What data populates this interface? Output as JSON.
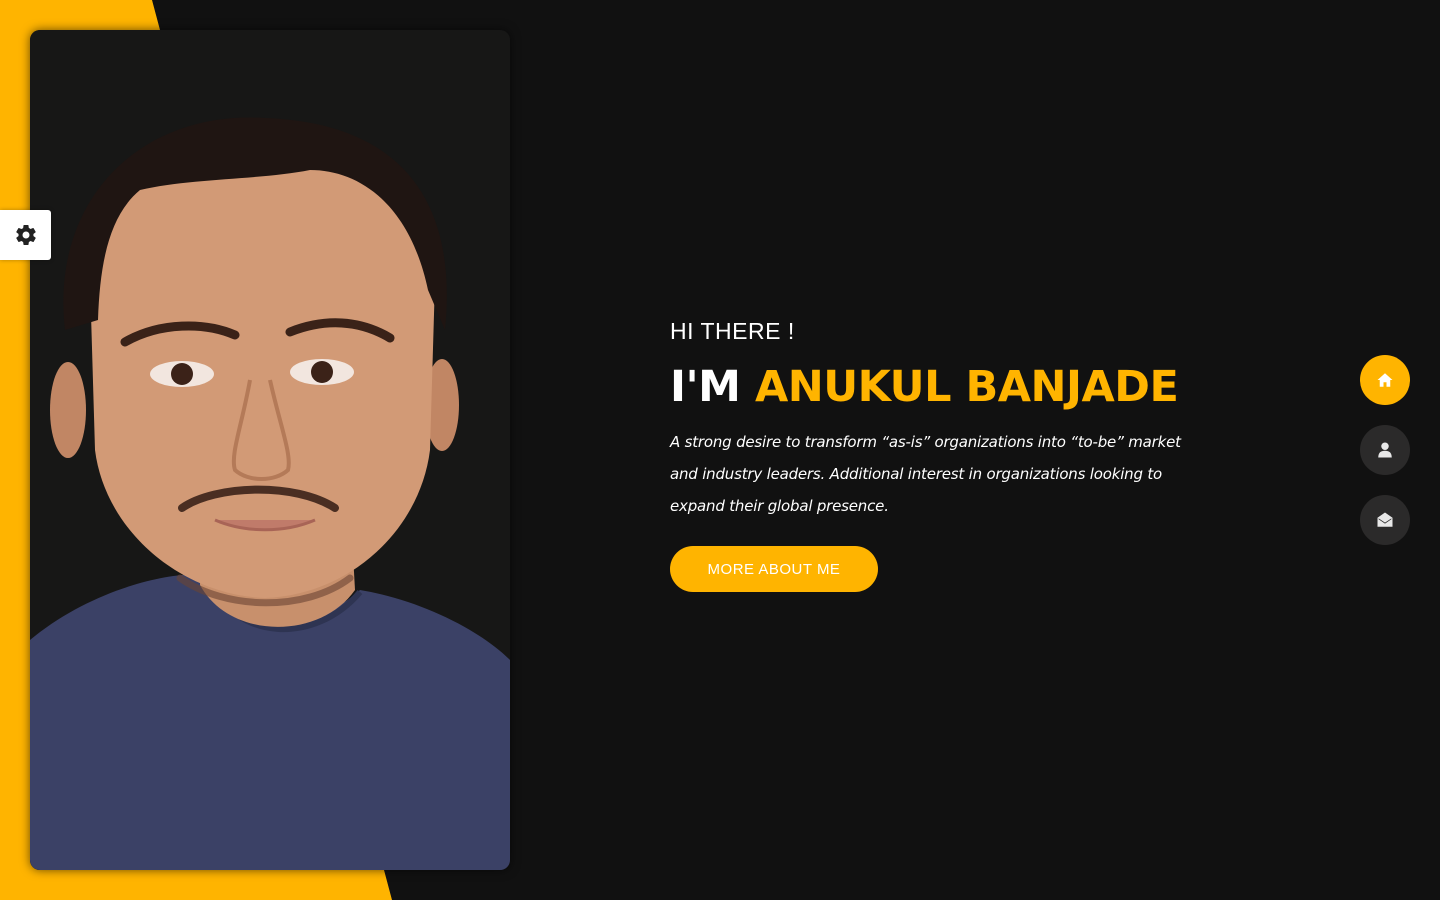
{
  "colors": {
    "accent": "#ffb400",
    "background": "#111111",
    "nav_button": "#2b2a2a",
    "text": "#ffffff"
  },
  "settings": {
    "icon": "gear-icon"
  },
  "hero": {
    "greeting": "HI THERE !",
    "headline_prefix": "I'M ",
    "headline_name": "ANUKUL BANJADE",
    "bio": "A strong desire to transform “as-is” organizations into “to-be” market and industry leaders. Additional interest in organizations looking to expand their global presence.",
    "cta_label": "MORE ABOUT ME"
  },
  "nav": {
    "items": [
      {
        "icon": "home-icon",
        "active": true
      },
      {
        "icon": "user-icon",
        "active": false
      },
      {
        "icon": "envelope-open-icon",
        "active": false
      }
    ]
  }
}
